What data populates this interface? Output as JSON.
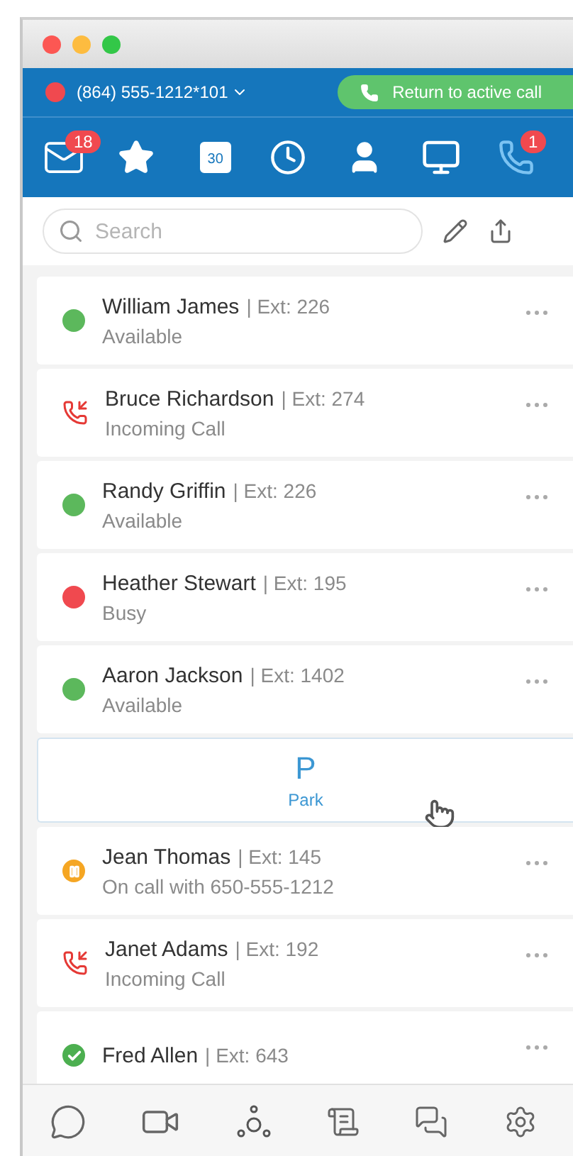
{
  "account": {
    "number": "(864) 555-1212*101"
  },
  "active_call_button": {
    "label": "Return to active call"
  },
  "nav": [
    {
      "kind": "mail",
      "badge": "18",
      "selected": false
    },
    {
      "kind": "star",
      "selected": false
    },
    {
      "kind": "calendar",
      "label": "30",
      "selected": false
    },
    {
      "kind": "clock",
      "selected": false
    },
    {
      "kind": "user",
      "selected": false
    },
    {
      "kind": "monitor",
      "selected": false
    },
    {
      "kind": "phone",
      "badge": "1",
      "selected": true
    }
  ],
  "search": {
    "placeholder": "Search"
  },
  "list": [
    {
      "kind": "available",
      "name": "William James",
      "ext": "| Ext: 226",
      "status_text": "Available"
    },
    {
      "kind": "incoming",
      "name": "Bruce Richardson",
      "ext": "| Ext: 274",
      "status_text": "Incoming Call"
    },
    {
      "kind": "available",
      "name": "Randy Griffin",
      "ext": "| Ext: 226",
      "status_text": "Available"
    },
    {
      "kind": "busy",
      "name": "Heather Stewart",
      "ext": "| Ext: 195",
      "status_text": "Busy"
    },
    {
      "kind": "available",
      "name": "Aaron Jackson",
      "ext": "| Ext: 1402",
      "status_text": "Available"
    },
    {
      "kind": "park",
      "letter": "P",
      "label": "Park"
    },
    {
      "kind": "on_hold",
      "name": "Jean Thomas",
      "ext": "| Ext: 145",
      "status_text": "On call with 650-555-1212"
    },
    {
      "kind": "incoming",
      "name": "Janet Adams",
      "ext": "| Ext: 192",
      "status_text": "Incoming Call"
    },
    {
      "kind": "verified",
      "name": "Fred Allen",
      "ext": "| Ext: 643"
    }
  ]
}
